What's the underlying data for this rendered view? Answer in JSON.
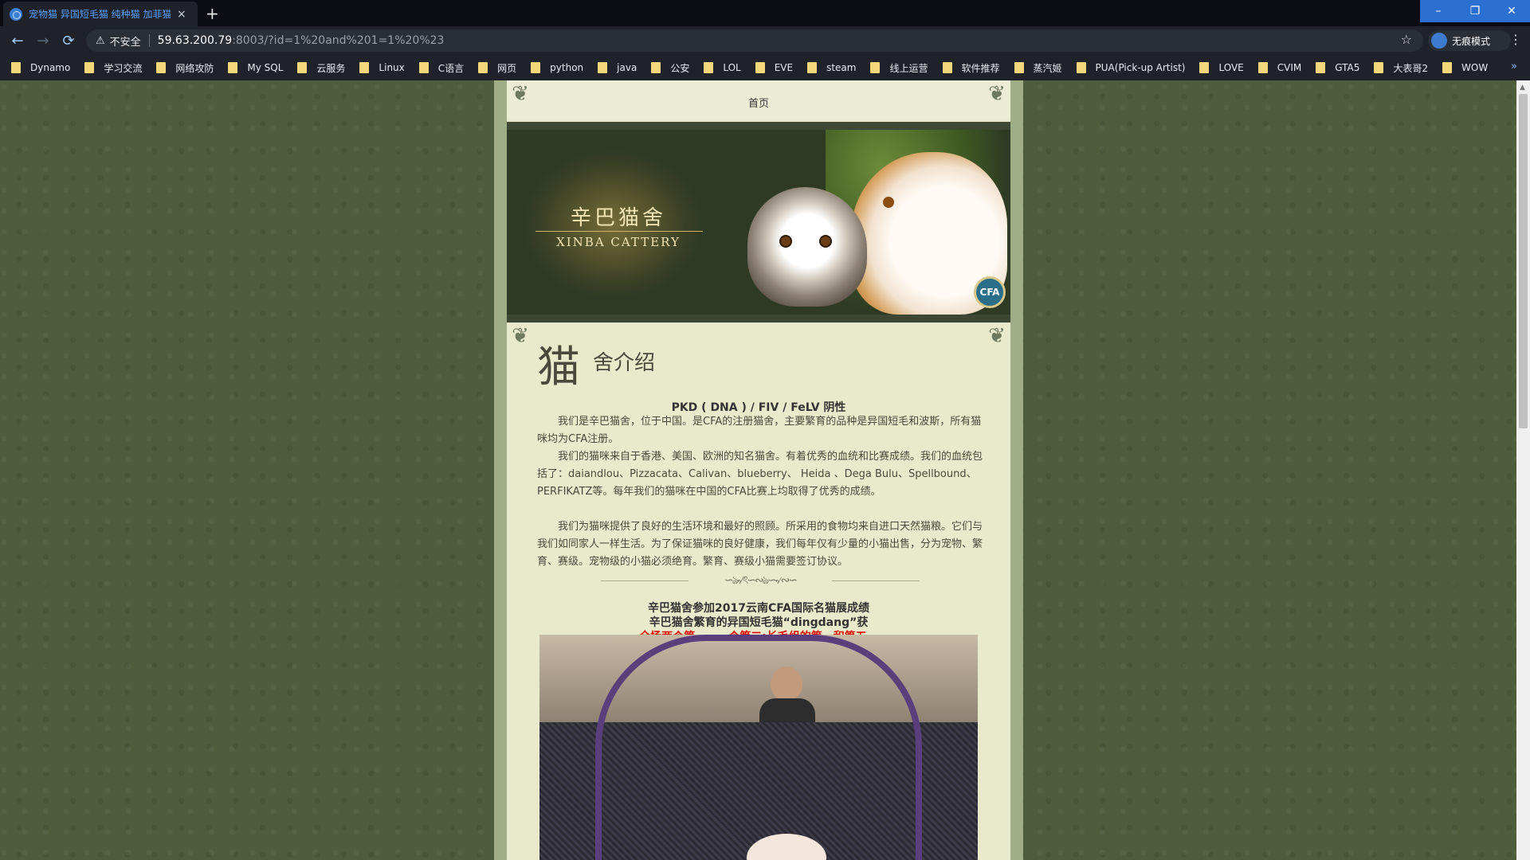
{
  "browser": {
    "tab_title": "宠物猫 异国短毛猫 纯种猫 加菲猫",
    "tab_close": "×",
    "new_tab": "+",
    "window_controls": [
      "–",
      "❐",
      "✕"
    ],
    "nav": {
      "back": "←",
      "forward": "→",
      "reload": "⟳"
    },
    "security_warning": "⚠",
    "security_label": "不安全",
    "url_host": "59.63.200.79",
    "url_rest": ":8003/?id=1%20and%201=1%20%23",
    "bookmark_star": "☆",
    "incognito_label": "无痕模式",
    "menu": "⋮",
    "bookmarks": [
      "Dynamo",
      "学习交流",
      "网络攻防",
      "My SQL",
      "云服务",
      "Linux",
      "C语言",
      "网页",
      "python",
      "java",
      "公安",
      "LOL",
      "EVE",
      "steam",
      "线上运营",
      "软件推荐",
      "蒸汽姬",
      "PUA(Pick-up Artist)",
      "LOVE",
      "CVIM",
      "GTA5",
      "大表哥2",
      "WOW"
    ],
    "bookmarks_more": "»"
  },
  "page": {
    "nav_home": "首页",
    "banner": {
      "logo_cn": "辛巴猫舍",
      "logo_en": "XINBA CATTERY",
      "badge": "CFA"
    },
    "heading_big": "猫",
    "heading_small": "舍介绍",
    "test_line": "PKD ( DNA ) / FIV / FeLV 阴性",
    "paragraphs": [
      "我们是辛巴猫舍，位于中国。是CFA的注册猫舍，主要繁育的品种是异国短毛和波斯，所有猫咪均为CFA注册。",
      "我们的猫咪来自于香港、美国、欧洲的知名猫舍。有着优秀的血统和比赛成绩。我们的血统包括了：daiandlou、Pizzacata、Calivan、blueberry、 Heida 、Dega Bulu、Spellbound、PERFIKATZ等。每年我们的猫咪在中国的CFA比赛上均取得了优秀的成绩。",
      "我们为猫咪提供了良好的生活环境和最好的照顾。所采用的食物均来自进口天然猫粮。它们与我们如同家人一样生活。为了保证猫咪的良好健康，我们每年仅有少量的小猫出售，分为宠物、繁育、赛级。宠物级的小猫必须绝育。繁育、赛级小猫需要签订协议。"
    ],
    "divider_ornament": "∽ঌ৵ৎ∽∾ঌ∽৵∾∽",
    "news_title": "辛巴猫舍参加2017云南CFA国际名猫展成绩",
    "news_sub": "辛巴猫舍繁育的异国短毛猫“dingdang”获",
    "news_highlight": "全场两个第一，一个第二;长毛组的第一和第五。",
    "corner_ornament": "❦"
  },
  "colors": {
    "tab_text": "#5aa0ff",
    "window_control_bg": "#2b6fd1",
    "page_bg": "#4e5d3c",
    "content_bg": "#e9eacb",
    "highlight_red": "#e00000",
    "folder_icon": "#f3d77a"
  }
}
